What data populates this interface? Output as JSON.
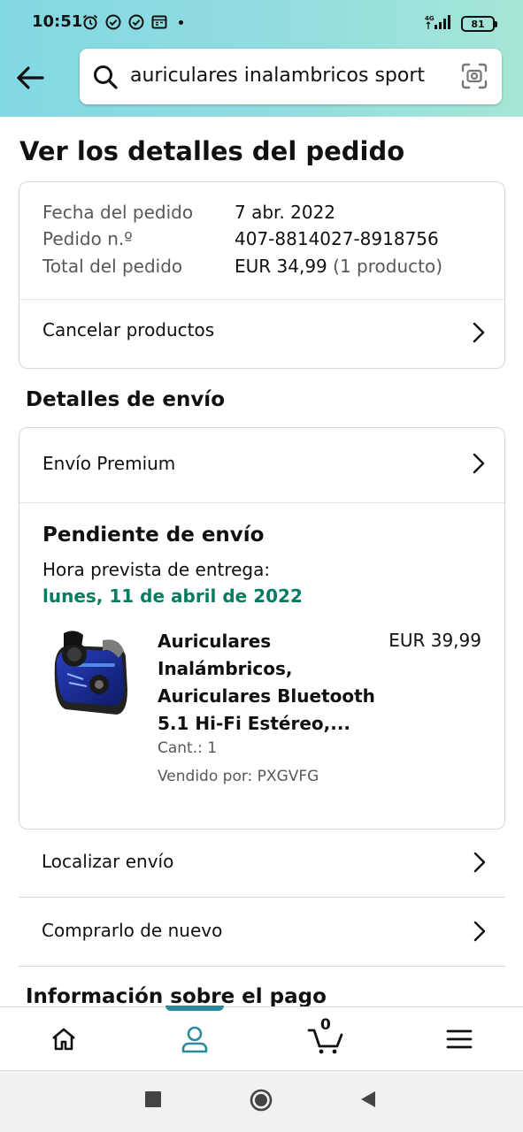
{
  "status_bar": {
    "time": "10:51",
    "network": "4G",
    "battery": "81"
  },
  "search": {
    "query": "auriculares inalambricos sport"
  },
  "page": {
    "title": "Ver los detalles del pedido"
  },
  "order": {
    "date_label": "Fecha del pedido",
    "date_value": "7 abr. 2022",
    "number_label": "Pedido n.º",
    "number_value": "407-8814027-8918756",
    "total_label": "Total del pedido",
    "total_value": "EUR 34,99",
    "total_items": "(1 producto)",
    "cancel_label": "Cancelar productos"
  },
  "shipping": {
    "section_title": "Detalles de envío",
    "shipping_method": "Envío Premium",
    "status": "Pendiente de envío",
    "eta_label": "Hora prevista de entrega:",
    "eta_date": "lunes, 11 de abril de 2022"
  },
  "product": {
    "title": "Auriculares Inalámbricos, Auriculares Bluetooth 5.1 Hi-Fi Estéreo,...",
    "price": "EUR 39,99",
    "quantity": "Cant.: 1",
    "seller": "Vendido por: PXGVFG"
  },
  "actions": {
    "track": "Localizar envío",
    "buy_again": "Comprarlo de nuevo"
  },
  "payment": {
    "section_title": "Información sobre el pago"
  },
  "bottom_nav": {
    "cart_count": "0",
    "items": [
      "home-icon",
      "account-icon",
      "cart-icon",
      "menu-icon"
    ]
  },
  "colors": {
    "accent_green": "#067d62",
    "nav_active": "#2a8a9c",
    "header_gradient_start": "#82d8e3",
    "header_gradient_end": "#a5e6d5"
  }
}
